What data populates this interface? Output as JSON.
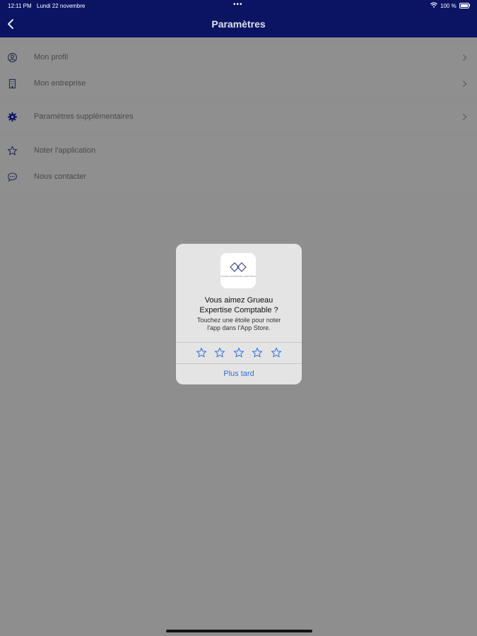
{
  "status_bar": {
    "time": "12:11 PM",
    "date": "Lundi 22 novembre",
    "dots": "•••",
    "battery": "100 %"
  },
  "nav": {
    "title": "Paramètres",
    "back_icon": "chevron-left-icon"
  },
  "settings": {
    "group1": [
      {
        "label": "Mon profil",
        "icon": "user-circle-icon"
      },
      {
        "label": "Mon entreprise",
        "icon": "building-icon"
      }
    ],
    "group2": [
      {
        "label": "Paramètres supplémentaires",
        "icon": "gear-icon"
      }
    ],
    "group3": [
      {
        "label": "Noter l'application",
        "icon": "star-icon"
      },
      {
        "label": "Nous contacter",
        "icon": "chat-bubble-icon"
      }
    ]
  },
  "rating_dialog": {
    "logo_caption": "GRUEAU EXPERTISE COMPTABLE",
    "title_line1": "Vous aimez Grueau",
    "title_line2": "Expertise Comptable ?",
    "message_line1": "Touchez une étoile pour noter",
    "message_line2": "l'app dans l'App Store.",
    "star_count": 5,
    "later_label": "Plus tard",
    "accent_color": "#2f6fe0"
  },
  "colors": {
    "nav_background": "#0a1463",
    "dim_background": "#8e8e8e"
  }
}
